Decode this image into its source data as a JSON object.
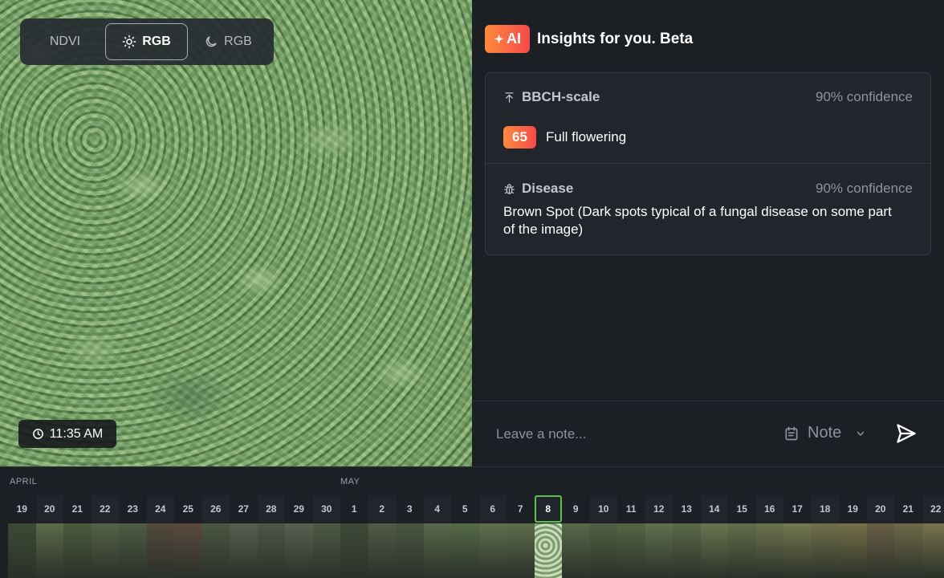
{
  "photo": {
    "modes": [
      {
        "label": "NDVI",
        "icon": "",
        "active": false
      },
      {
        "label": "RGB",
        "icon": "sun-icon",
        "active": true
      },
      {
        "label": "RGB",
        "icon": "moon-icon",
        "active": false
      }
    ],
    "time": "11:35 AM"
  },
  "insights": {
    "ai_label": "AI",
    "title": "Insights for you. Beta",
    "bbch": {
      "label": "BBCH-scale",
      "confidence": "90% confidence",
      "stage_number": "65",
      "stage_name": "Full flowering"
    },
    "disease": {
      "label": "Disease",
      "confidence": "90% confidence",
      "text": "Brown Spot (Dark spots typical of a fungal disease on some part of the image)"
    },
    "note": {
      "placeholder": "Leave a note...",
      "type_label": "Note"
    }
  },
  "timeline": {
    "months": [
      {
        "label": "APRIL"
      },
      {
        "label": "MAY"
      }
    ],
    "days": [
      "19",
      "20",
      "21",
      "22",
      "23",
      "24",
      "25",
      "26",
      "27",
      "28",
      "29",
      "30",
      "1",
      "2",
      "3",
      "4",
      "5",
      "6",
      "7",
      "8",
      "9",
      "10",
      "11",
      "12",
      "13",
      "14",
      "15",
      "16",
      "17",
      "18",
      "19",
      "20",
      "21",
      "22"
    ],
    "selected_day": "8",
    "thumb_colors": [
      "#3b4a35",
      "#5c6b4a",
      "#4a5a3d",
      "#556347",
      "#4d5c43",
      "#53483c",
      "#5b4a3e",
      "#4b5643",
      "#585f4f",
      "#4f5645",
      "#5a6150",
      "#4e5a44",
      "#3f4a38",
      "#515b46",
      "#4a5640",
      "#5a6a4b",
      "#556a46",
      "#607050",
      "#5d6d4c",
      "#8fb07a",
      "#58684a",
      "#4f6042",
      "#566546",
      "#61704e",
      "#5a6849",
      "#68764f",
      "#606e4a",
      "#6c734e",
      "#73794f",
      "#6f704a",
      "#757048",
      "#695e45",
      "#6c6a48",
      "#76744d"
    ]
  }
}
